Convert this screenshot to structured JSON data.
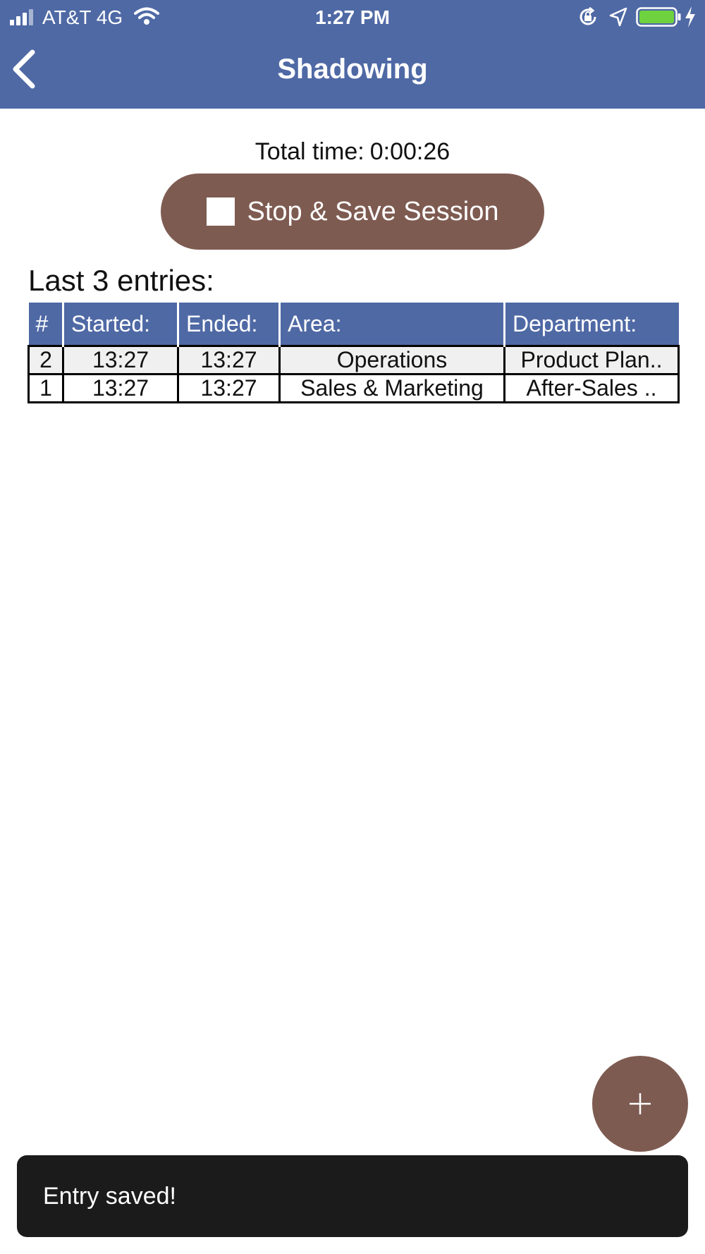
{
  "status_bar": {
    "carrier": "AT&T 4G",
    "time": "1:27 PM",
    "battery_color": "#6fd23f"
  },
  "header": {
    "title": "Shadowing",
    "back_icon": "chevron-left-icon",
    "background": "#4f69a5"
  },
  "session": {
    "total_time_label": "Total time:",
    "total_time_value": "0:00:26",
    "stop_button_label": "Stop & Save Session",
    "button_color": "#7e5b51"
  },
  "entries": {
    "title": "Last 3 entries:",
    "columns": [
      "#",
      "Started:",
      "Ended:",
      "Area:",
      "Department:"
    ],
    "rows": [
      {
        "num": "2",
        "started": "13:27",
        "ended": "13:27",
        "area": "Operations",
        "department": "Product Plan.."
      },
      {
        "num": "1",
        "started": "13:27",
        "ended": "13:27",
        "area": "Sales & Marketing",
        "department": "After-Sales .."
      }
    ]
  },
  "fab": {
    "icon": "plus-icon"
  },
  "snackbar": {
    "message": "Entry saved!"
  }
}
